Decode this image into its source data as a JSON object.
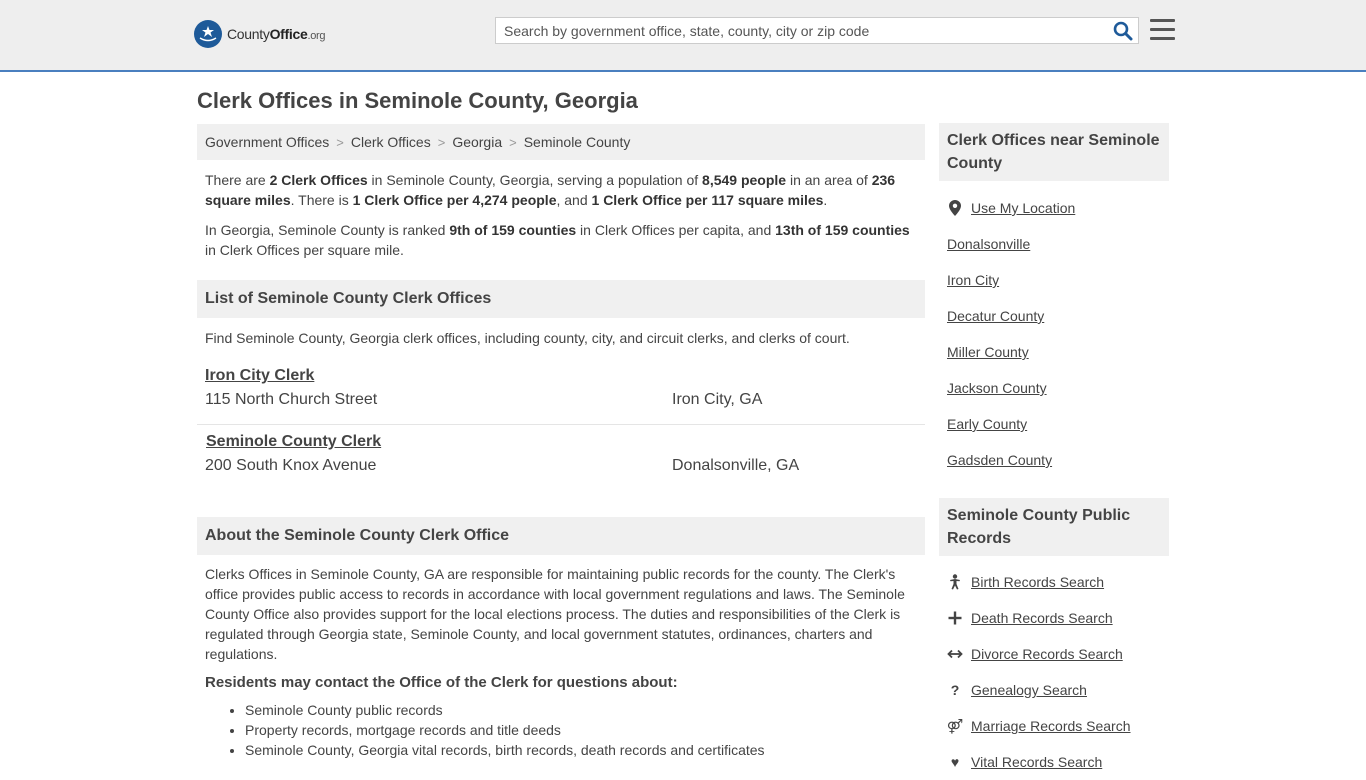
{
  "header": {
    "logo": {
      "county": "County",
      "office": "Office",
      "tld": ".org"
    },
    "search_placeholder": "Search by government office, state, county, city or zip code",
    "search_value": ""
  },
  "page_title": "Clerk Offices in Seminole County, Georgia",
  "breadcrumb": [
    "Government Offices",
    "Clerk Offices",
    "Georgia",
    "Seminole County"
  ],
  "summary": {
    "p1": [
      "There are ",
      "2 Clerk Offices",
      " in Seminole County, Georgia, serving a population of ",
      "8,549 people",
      " in an area of ",
      "236 square miles",
      ". There is ",
      "1 Clerk Office per 4,274 people",
      ", and ",
      "1 Clerk Office per 117 square miles",
      "."
    ],
    "p2": [
      "In Georgia, Seminole County is ranked ",
      "9th of 159 counties",
      " in Clerk Offices per capita, and ",
      "13th of 159 counties",
      " in Clerk Offices per square mile."
    ]
  },
  "list_section": {
    "heading": "List of Seminole County Clerk Offices",
    "intro": "Find Seminole County, Georgia clerk offices, including county, city, and circuit clerks, and clerks of court.",
    "offices": [
      {
        "name": "Iron City Clerk",
        "address": "115 North Church Street",
        "city": "Iron City, GA"
      },
      {
        "name": "Seminole County Clerk",
        "address": "200 South Knox Avenue",
        "city": "Donalsonville, GA"
      }
    ]
  },
  "about": {
    "heading": "About the Seminole County Clerk Office",
    "text": "Clerks Offices in Seminole County, GA are responsible for maintaining public records for the county. The Clerk's office provides public access to records in accordance with local government regulations and laws. The Seminole County Office also provides support for the local elections process. The duties and responsibilities of the Clerk is regulated through Georgia state, Seminole County, and local government statutes, ordinances, charters and regulations.",
    "residents_heading": "Residents may contact the Office of the Clerk for questions about:",
    "bullets": [
      "Seminole County public records",
      "Property records, mortgage records and title deeds",
      "Seminole County, Georgia vital records, birth records, death records and certificates"
    ]
  },
  "sidebar": {
    "near_heading": "Clerk Offices near Seminole County",
    "use_location": "Use My Location",
    "near_links": [
      "Donalsonville",
      "Iron City",
      "Decatur County",
      "Miller County",
      "Jackson County",
      "Early County",
      "Gadsden County"
    ],
    "records_heading": "Seminole County Public Records",
    "records_links": [
      {
        "label": "Birth Records Search",
        "icon": "baby-icon"
      },
      {
        "label": "Death Records Search",
        "icon": "cross-icon"
      },
      {
        "label": "Divorce Records Search",
        "icon": "arrows-icon"
      },
      {
        "label": "Genealogy Search",
        "icon": "question-icon"
      },
      {
        "label": "Marriage Records Search",
        "icon": "gender-icon"
      },
      {
        "label": "Vital Records Search",
        "icon": "heartbeat-icon"
      }
    ]
  },
  "colors": {
    "brand_blue": "#1e5a99",
    "header_border": "#4a7fbf",
    "search_icon": "#1e5a99"
  }
}
